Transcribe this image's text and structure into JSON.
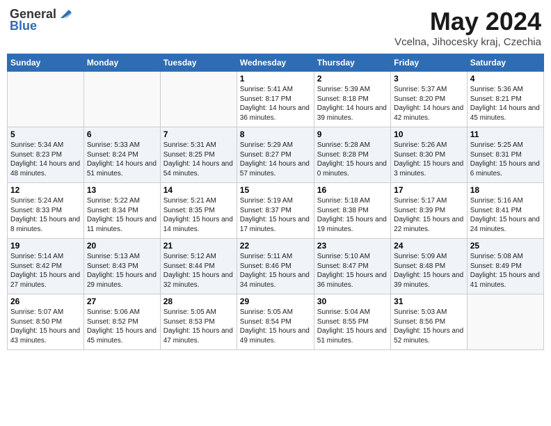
{
  "header": {
    "logo_general": "General",
    "logo_blue": "Blue",
    "month_title": "May 2024",
    "location": "Vcelna, Jihocesky kraj, Czechia"
  },
  "weekdays": [
    "Sunday",
    "Monday",
    "Tuesday",
    "Wednesday",
    "Thursday",
    "Friday",
    "Saturday"
  ],
  "weeks": [
    [
      {
        "day": "",
        "sunrise": "",
        "sunset": "",
        "daylight": ""
      },
      {
        "day": "",
        "sunrise": "",
        "sunset": "",
        "daylight": ""
      },
      {
        "day": "",
        "sunrise": "",
        "sunset": "",
        "daylight": ""
      },
      {
        "day": "1",
        "sunrise": "Sunrise: 5:41 AM",
        "sunset": "Sunset: 8:17 PM",
        "daylight": "Daylight: 14 hours and 36 minutes."
      },
      {
        "day": "2",
        "sunrise": "Sunrise: 5:39 AM",
        "sunset": "Sunset: 8:18 PM",
        "daylight": "Daylight: 14 hours and 39 minutes."
      },
      {
        "day": "3",
        "sunrise": "Sunrise: 5:37 AM",
        "sunset": "Sunset: 8:20 PM",
        "daylight": "Daylight: 14 hours and 42 minutes."
      },
      {
        "day": "4",
        "sunrise": "Sunrise: 5:36 AM",
        "sunset": "Sunset: 8:21 PM",
        "daylight": "Daylight: 14 hours and 45 minutes."
      }
    ],
    [
      {
        "day": "5",
        "sunrise": "Sunrise: 5:34 AM",
        "sunset": "Sunset: 8:23 PM",
        "daylight": "Daylight: 14 hours and 48 minutes."
      },
      {
        "day": "6",
        "sunrise": "Sunrise: 5:33 AM",
        "sunset": "Sunset: 8:24 PM",
        "daylight": "Daylight: 14 hours and 51 minutes."
      },
      {
        "day": "7",
        "sunrise": "Sunrise: 5:31 AM",
        "sunset": "Sunset: 8:25 PM",
        "daylight": "Daylight: 14 hours and 54 minutes."
      },
      {
        "day": "8",
        "sunrise": "Sunrise: 5:29 AM",
        "sunset": "Sunset: 8:27 PM",
        "daylight": "Daylight: 14 hours and 57 minutes."
      },
      {
        "day": "9",
        "sunrise": "Sunrise: 5:28 AM",
        "sunset": "Sunset: 8:28 PM",
        "daylight": "Daylight: 15 hours and 0 minutes."
      },
      {
        "day": "10",
        "sunrise": "Sunrise: 5:26 AM",
        "sunset": "Sunset: 8:30 PM",
        "daylight": "Daylight: 15 hours and 3 minutes."
      },
      {
        "day": "11",
        "sunrise": "Sunrise: 5:25 AM",
        "sunset": "Sunset: 8:31 PM",
        "daylight": "Daylight: 15 hours and 6 minutes."
      }
    ],
    [
      {
        "day": "12",
        "sunrise": "Sunrise: 5:24 AM",
        "sunset": "Sunset: 8:33 PM",
        "daylight": "Daylight: 15 hours and 8 minutes."
      },
      {
        "day": "13",
        "sunrise": "Sunrise: 5:22 AM",
        "sunset": "Sunset: 8:34 PM",
        "daylight": "Daylight: 15 hours and 11 minutes."
      },
      {
        "day": "14",
        "sunrise": "Sunrise: 5:21 AM",
        "sunset": "Sunset: 8:35 PM",
        "daylight": "Daylight: 15 hours and 14 minutes."
      },
      {
        "day": "15",
        "sunrise": "Sunrise: 5:19 AM",
        "sunset": "Sunset: 8:37 PM",
        "daylight": "Daylight: 15 hours and 17 minutes."
      },
      {
        "day": "16",
        "sunrise": "Sunrise: 5:18 AM",
        "sunset": "Sunset: 8:38 PM",
        "daylight": "Daylight: 15 hours and 19 minutes."
      },
      {
        "day": "17",
        "sunrise": "Sunrise: 5:17 AM",
        "sunset": "Sunset: 8:39 PM",
        "daylight": "Daylight: 15 hours and 22 minutes."
      },
      {
        "day": "18",
        "sunrise": "Sunrise: 5:16 AM",
        "sunset": "Sunset: 8:41 PM",
        "daylight": "Daylight: 15 hours and 24 minutes."
      }
    ],
    [
      {
        "day": "19",
        "sunrise": "Sunrise: 5:14 AM",
        "sunset": "Sunset: 8:42 PM",
        "daylight": "Daylight: 15 hours and 27 minutes."
      },
      {
        "day": "20",
        "sunrise": "Sunrise: 5:13 AM",
        "sunset": "Sunset: 8:43 PM",
        "daylight": "Daylight: 15 hours and 29 minutes."
      },
      {
        "day": "21",
        "sunrise": "Sunrise: 5:12 AM",
        "sunset": "Sunset: 8:44 PM",
        "daylight": "Daylight: 15 hours and 32 minutes."
      },
      {
        "day": "22",
        "sunrise": "Sunrise: 5:11 AM",
        "sunset": "Sunset: 8:46 PM",
        "daylight": "Daylight: 15 hours and 34 minutes."
      },
      {
        "day": "23",
        "sunrise": "Sunrise: 5:10 AM",
        "sunset": "Sunset: 8:47 PM",
        "daylight": "Daylight: 15 hours and 36 minutes."
      },
      {
        "day": "24",
        "sunrise": "Sunrise: 5:09 AM",
        "sunset": "Sunset: 8:48 PM",
        "daylight": "Daylight: 15 hours and 39 minutes."
      },
      {
        "day": "25",
        "sunrise": "Sunrise: 5:08 AM",
        "sunset": "Sunset: 8:49 PM",
        "daylight": "Daylight: 15 hours and 41 minutes."
      }
    ],
    [
      {
        "day": "26",
        "sunrise": "Sunrise: 5:07 AM",
        "sunset": "Sunset: 8:50 PM",
        "daylight": "Daylight: 15 hours and 43 minutes."
      },
      {
        "day": "27",
        "sunrise": "Sunrise: 5:06 AM",
        "sunset": "Sunset: 8:52 PM",
        "daylight": "Daylight: 15 hours and 45 minutes."
      },
      {
        "day": "28",
        "sunrise": "Sunrise: 5:05 AM",
        "sunset": "Sunset: 8:53 PM",
        "daylight": "Daylight: 15 hours and 47 minutes."
      },
      {
        "day": "29",
        "sunrise": "Sunrise: 5:05 AM",
        "sunset": "Sunset: 8:54 PM",
        "daylight": "Daylight: 15 hours and 49 minutes."
      },
      {
        "day": "30",
        "sunrise": "Sunrise: 5:04 AM",
        "sunset": "Sunset: 8:55 PM",
        "daylight": "Daylight: 15 hours and 51 minutes."
      },
      {
        "day": "31",
        "sunrise": "Sunrise: 5:03 AM",
        "sunset": "Sunset: 8:56 PM",
        "daylight": "Daylight: 15 hours and 52 minutes."
      },
      {
        "day": "",
        "sunrise": "",
        "sunset": "",
        "daylight": ""
      }
    ]
  ]
}
